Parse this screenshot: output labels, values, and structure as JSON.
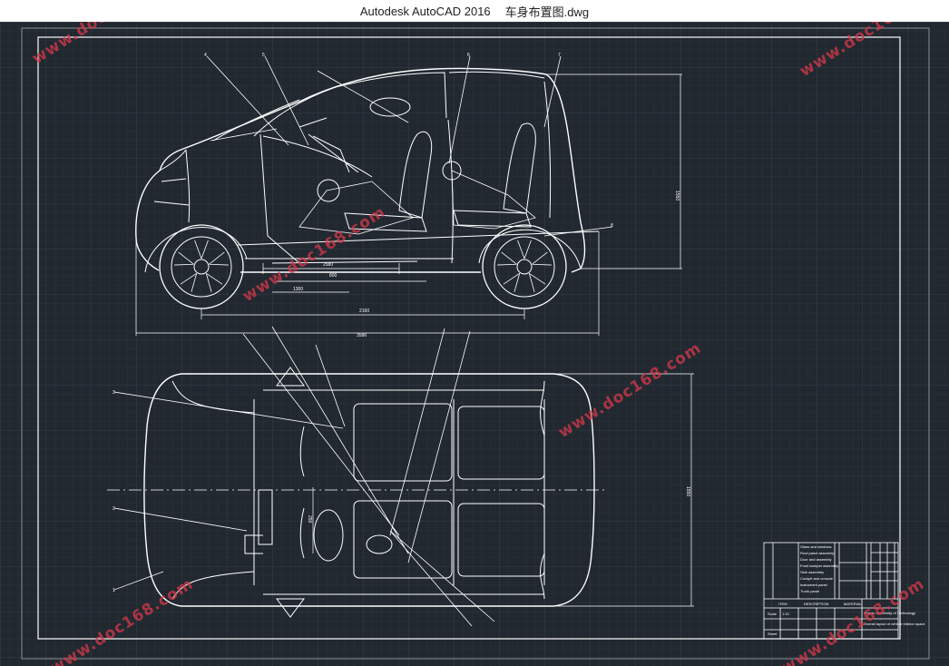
{
  "window": {
    "app_name": "Autodesk AutoCAD 2016",
    "file_name": "车身布置图.dwg"
  },
  "colors": {
    "background": "#212830",
    "line": "#ffffff",
    "watermark": "#d9394a"
  },
  "watermark": "www.doc168.com",
  "dimensions": {
    "side_total": "3586",
    "side_wheelbase": "2160",
    "side_height": "1550",
    "side_2580": "2580",
    "side_800": "800",
    "side_1300": "1300",
    "top_width": "1550",
    "seat_250": "250"
  },
  "part_labels": [
    "4",
    "5",
    "6",
    "7",
    "8",
    "3",
    "2",
    "1"
  ],
  "title_block": {
    "rows": [
      "Glass and windows",
      "Roof panel assembly",
      "Door and assembly",
      "Front bumper assembly",
      "Side assembly",
      "Cockpit and console",
      "Instrument panel",
      "Trunk panel"
    ],
    "header_item": "ITEM",
    "header_description": "DESCRIPTION",
    "header_material": "MATERIAL",
    "university": "Wuhan University of Technology",
    "drawing_title": "Overall layout of vehicle interior space",
    "scale_label": "Scale",
    "scale_value": "1:10",
    "sheet_label": "Sheet"
  }
}
